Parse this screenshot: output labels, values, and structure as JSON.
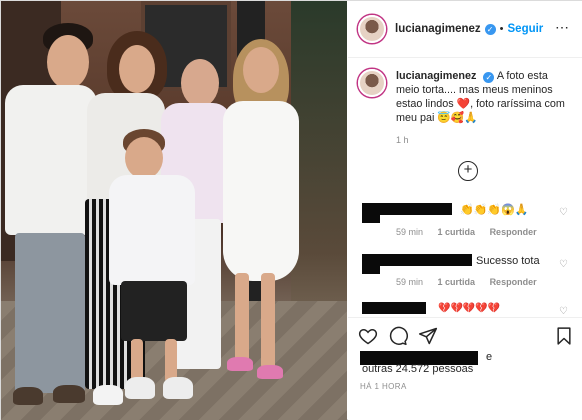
{
  "header": {
    "username": "lucianagimenez",
    "follow_label": "Seguir",
    "separator": "•"
  },
  "caption": {
    "username": "lucianagimenez",
    "text": "A foto esta meio torta.... mas meus meninos estao lindos ❤️, foto raríssima com meu pai 😇🥰🙏",
    "time": "1 h"
  },
  "comments": [
    {
      "text": "👏👏👏😱🙏",
      "time": "59 min",
      "likes": "1 curtida",
      "reply": "Responder"
    },
    {
      "text": "Sucesso tota",
      "time": "59 min",
      "likes": "1 curtida",
      "reply": "Responder"
    },
    {
      "text": "💔💔💔💔💔",
      "time": "",
      "likes": "",
      "reply": ""
    }
  ],
  "likes": {
    "suffix": "e",
    "rest": "outras 24.572 pessoas"
  },
  "timestamp": "HÁ 1 HORA",
  "colors": {
    "link_blue": "#0095f6",
    "verified_blue": "#3897f0",
    "heart_red": "#ed4956",
    "muted": "#8e8e8e"
  },
  "icons": {
    "like": "heart-outline-icon",
    "comment": "comment-bubble-icon",
    "share": "paper-plane-icon",
    "save": "bookmark-icon",
    "add_comment": "plus-circle-icon",
    "more": "more-options-icon"
  }
}
